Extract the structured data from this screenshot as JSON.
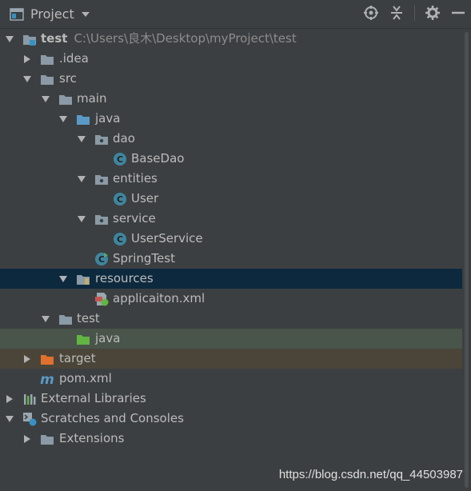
{
  "toolbar": {
    "title": "Project",
    "icons": [
      "project-window-icon",
      "dropdown-arrow-icon",
      "locate-icon",
      "collapse-all-icon",
      "gear-icon",
      "hide-icon"
    ]
  },
  "tree": {
    "root_name": "test",
    "root_path": "C:\\Users\\良木\\Desktop\\myProject\\test",
    "idea": ".idea",
    "src": "src",
    "main": "main",
    "java_main": "java",
    "dao": "dao",
    "basedao": "BaseDao",
    "entities": "entities",
    "user": "User",
    "service": "service",
    "userservice": "UserService",
    "springtest": "SpringTest",
    "resources": "resources",
    "applicaiton_xml": "applicaiton.xml",
    "test_dir": "test",
    "java_test": "java",
    "target": "target",
    "pom": "pom.xml",
    "external_libraries": "External Libraries",
    "scratches": "Scratches and Consoles",
    "extensions": "Extensions"
  },
  "watermark": "https://blog.csdn.net/qq_44503987",
  "colors": {
    "background": "#3c3f41",
    "selected_row": "#0d293e",
    "test_source_row": "#49544a",
    "excluded_row": "#4a4538",
    "folder": "#8a9aa6",
    "source_folder": "#5a9ac6",
    "test_folder": "#62b543",
    "excluded_folder": "#e0702e",
    "class_icon": "#3e86a0"
  }
}
